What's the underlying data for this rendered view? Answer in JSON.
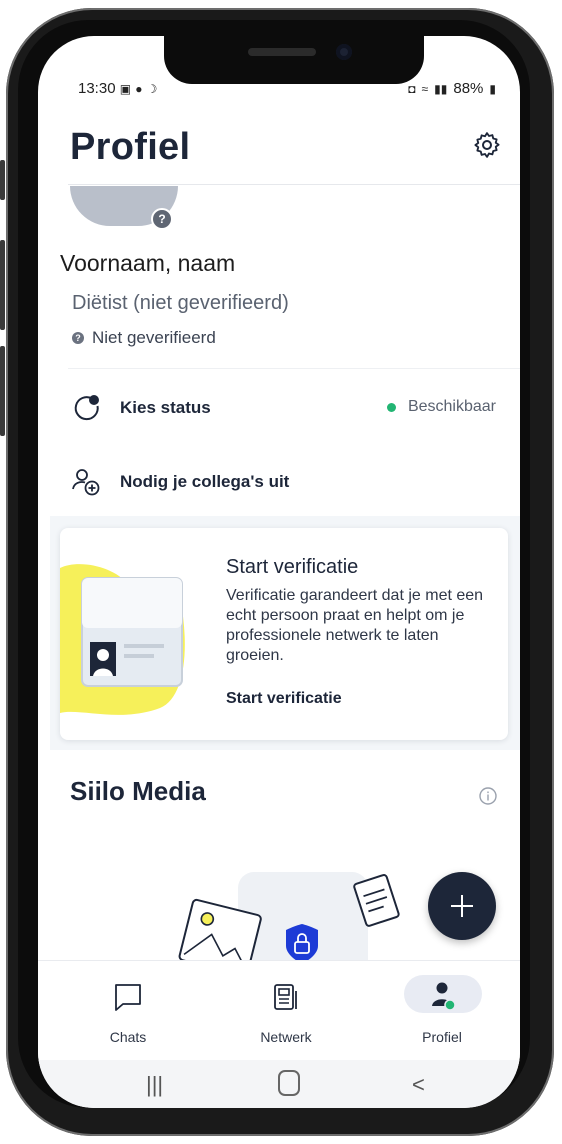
{
  "status_bar": {
    "time": "13:30",
    "battery": "88%"
  },
  "header": {
    "title": "Profiel"
  },
  "profile": {
    "name": "Voornaam, naam",
    "role": "Diëtist (niet geverifieerd)",
    "verification": "Niet geverifieerd"
  },
  "status_row": {
    "label": "Kies status",
    "value": "Beschikbaar"
  },
  "invite_row": {
    "label": "Nodig je collega's uit"
  },
  "verification_card": {
    "title": "Start verificatie",
    "text": "Verificatie garandeert dat je met een echt persoon praat en helpt om je professionele netwerk te laten groeien.",
    "link": "Start verificatie"
  },
  "media": {
    "title": "Siilo Media"
  },
  "bottom_nav": {
    "items": [
      {
        "label": "Chats",
        "icon": "chat-bubble-icon"
      },
      {
        "label": "Netwerk",
        "icon": "network-icon"
      },
      {
        "label": "Profiel",
        "icon": "profile-icon",
        "active": true
      }
    ]
  },
  "colors": {
    "primary": "#1d2639",
    "available": "#22b573",
    "highlight": "#f6f05a"
  }
}
